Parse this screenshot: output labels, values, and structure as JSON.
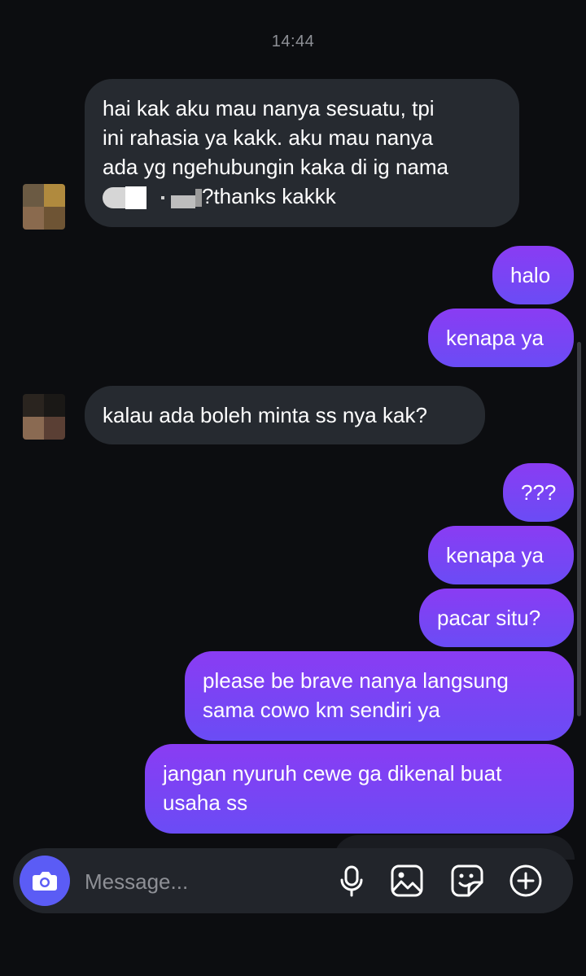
{
  "timestamp": "14:44",
  "messages": [
    {
      "side": "incoming",
      "text_lines": [
        "hai kak aku mau nanya sesuatu, tpi",
        "ini rahasia ya kakk. aku mau nanya",
        "ada yg ngehubungin kaka di ig nama"
      ],
      "last_line_suffix": "?thanks kakkk"
    },
    {
      "side": "outgoing",
      "text": "halo"
    },
    {
      "side": "outgoing",
      "text": "kenapa ya"
    },
    {
      "side": "incoming",
      "text": "kalau ada boleh minta ss nya kak?"
    },
    {
      "side": "outgoing",
      "text": "???"
    },
    {
      "side": "outgoing",
      "text": "kenapa ya"
    },
    {
      "side": "outgoing",
      "text": "pacar situ?"
    },
    {
      "side": "outgoing",
      "text_lines": [
        "please be brave nanya langsung",
        "sama cowo km sendiri ya"
      ]
    },
    {
      "side": "outgoing",
      "text_lines": [
        "jangan nyuruh cewe ga dikenal buat",
        "usaha ss"
      ]
    }
  ],
  "composer": {
    "placeholder": "Message...",
    "icons": [
      "camera-icon",
      "microphone-icon",
      "gallery-icon",
      "sticker-icon",
      "add-icon"
    ]
  },
  "colors": {
    "background": "#0c0d10",
    "incoming_bubble": "#262a30",
    "outgoing_bubble": "#7b3ff2",
    "composer": "#22252b",
    "camera_button": "#5b5cf5"
  }
}
